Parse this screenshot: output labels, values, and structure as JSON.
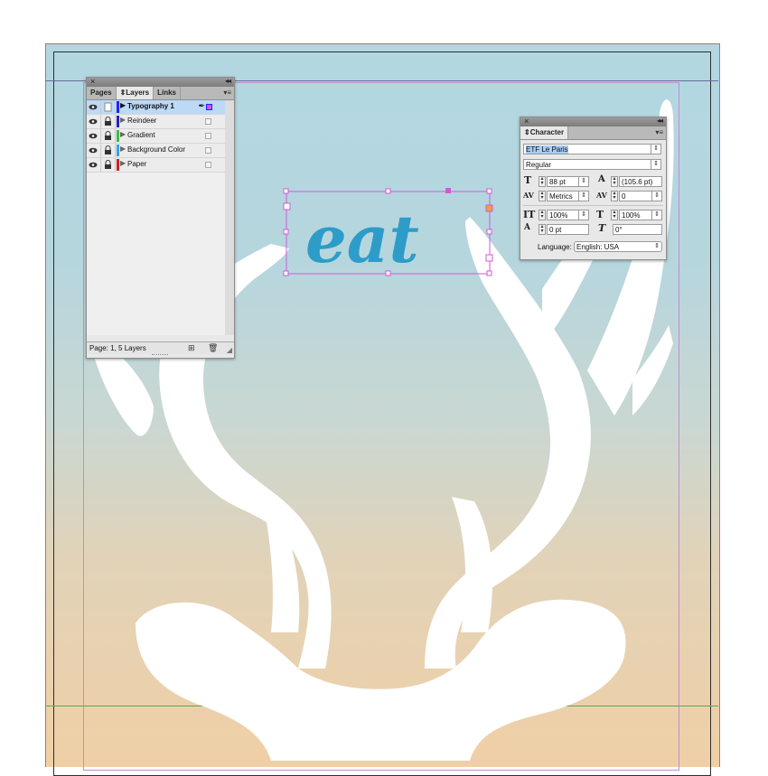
{
  "document": {
    "headline_text": "eat"
  },
  "colors": {
    "page_top": "#b2d7e1",
    "page_bottom": "#f0cfa6",
    "headline": "#2e9cc8",
    "selection": "#d05ad8",
    "margin_guide": "#c58ad8"
  },
  "layers_panel": {
    "tabs": [
      "Pages",
      "Layers",
      "Links"
    ],
    "active_tab": "Layers",
    "layers": [
      {
        "name": "Typography 1",
        "color": "#2020ff",
        "selected": true
      },
      {
        "name": "Reindeer",
        "color": "#2020c8",
        "selected": false
      },
      {
        "name": "Gradient",
        "color": "#38c040",
        "selected": false
      },
      {
        "name": "Background Color",
        "color": "#3aa0e8",
        "selected": false
      },
      {
        "name": "Paper",
        "color": "#d02020",
        "selected": false
      }
    ],
    "footer_status": "Page: 1, 5 Layers"
  },
  "character_panel": {
    "title": "Character",
    "font_family": "ETF Le Paris",
    "font_style": "Regular",
    "font_size": "88 pt",
    "leading": "(105.6 pt)",
    "kerning": "Metrics",
    "tracking": "0",
    "vertical_scale": "100%",
    "horizontal_scale": "100%",
    "baseline_shift": "0 pt",
    "skew": "0°",
    "language_label": "Language:",
    "language_value": "English: USA"
  },
  "icons": {
    "close": "close-icon",
    "collapse": "double-chevron-icon",
    "eye": "eye-icon",
    "lock": "lock-icon",
    "new_layer": "new-layer-icon",
    "trash": "trash-icon"
  }
}
